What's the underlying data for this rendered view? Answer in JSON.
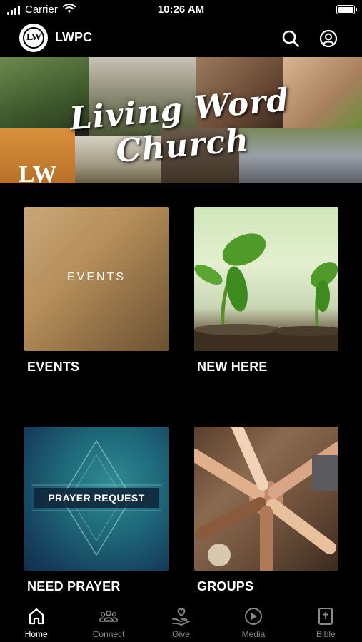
{
  "status_bar": {
    "carrier": "Carrier",
    "time": "10:26 AM",
    "battery_level": 1.0
  },
  "header": {
    "logo_text": "LW",
    "app_title": "LWPC",
    "search_icon": "search-icon",
    "account_icon": "user-circle-icon"
  },
  "banner": {
    "title": "Living Word Church",
    "logo_mark": "LW"
  },
  "cards": [
    {
      "label": "EVENTS",
      "overlay_text": "EVENTS"
    },
    {
      "label": "NEW HERE"
    },
    {
      "label": "NEED PRAYER",
      "overlay_text": "PRAYER REQUEST"
    },
    {
      "label": "GROUPS"
    }
  ],
  "tabs": [
    {
      "label": "Home",
      "icon": "home-icon",
      "active": true
    },
    {
      "label": "Connect",
      "icon": "group-icon",
      "active": false
    },
    {
      "label": "Give",
      "icon": "heart-hand-icon",
      "active": false
    },
    {
      "label": "Media",
      "icon": "play-circle-icon",
      "active": false
    },
    {
      "label": "Bible",
      "icon": "bible-icon",
      "active": false
    }
  ],
  "colors": {
    "background": "#000000",
    "active_tab": "#ffffff",
    "inactive_tab": "#8a8a8a"
  }
}
